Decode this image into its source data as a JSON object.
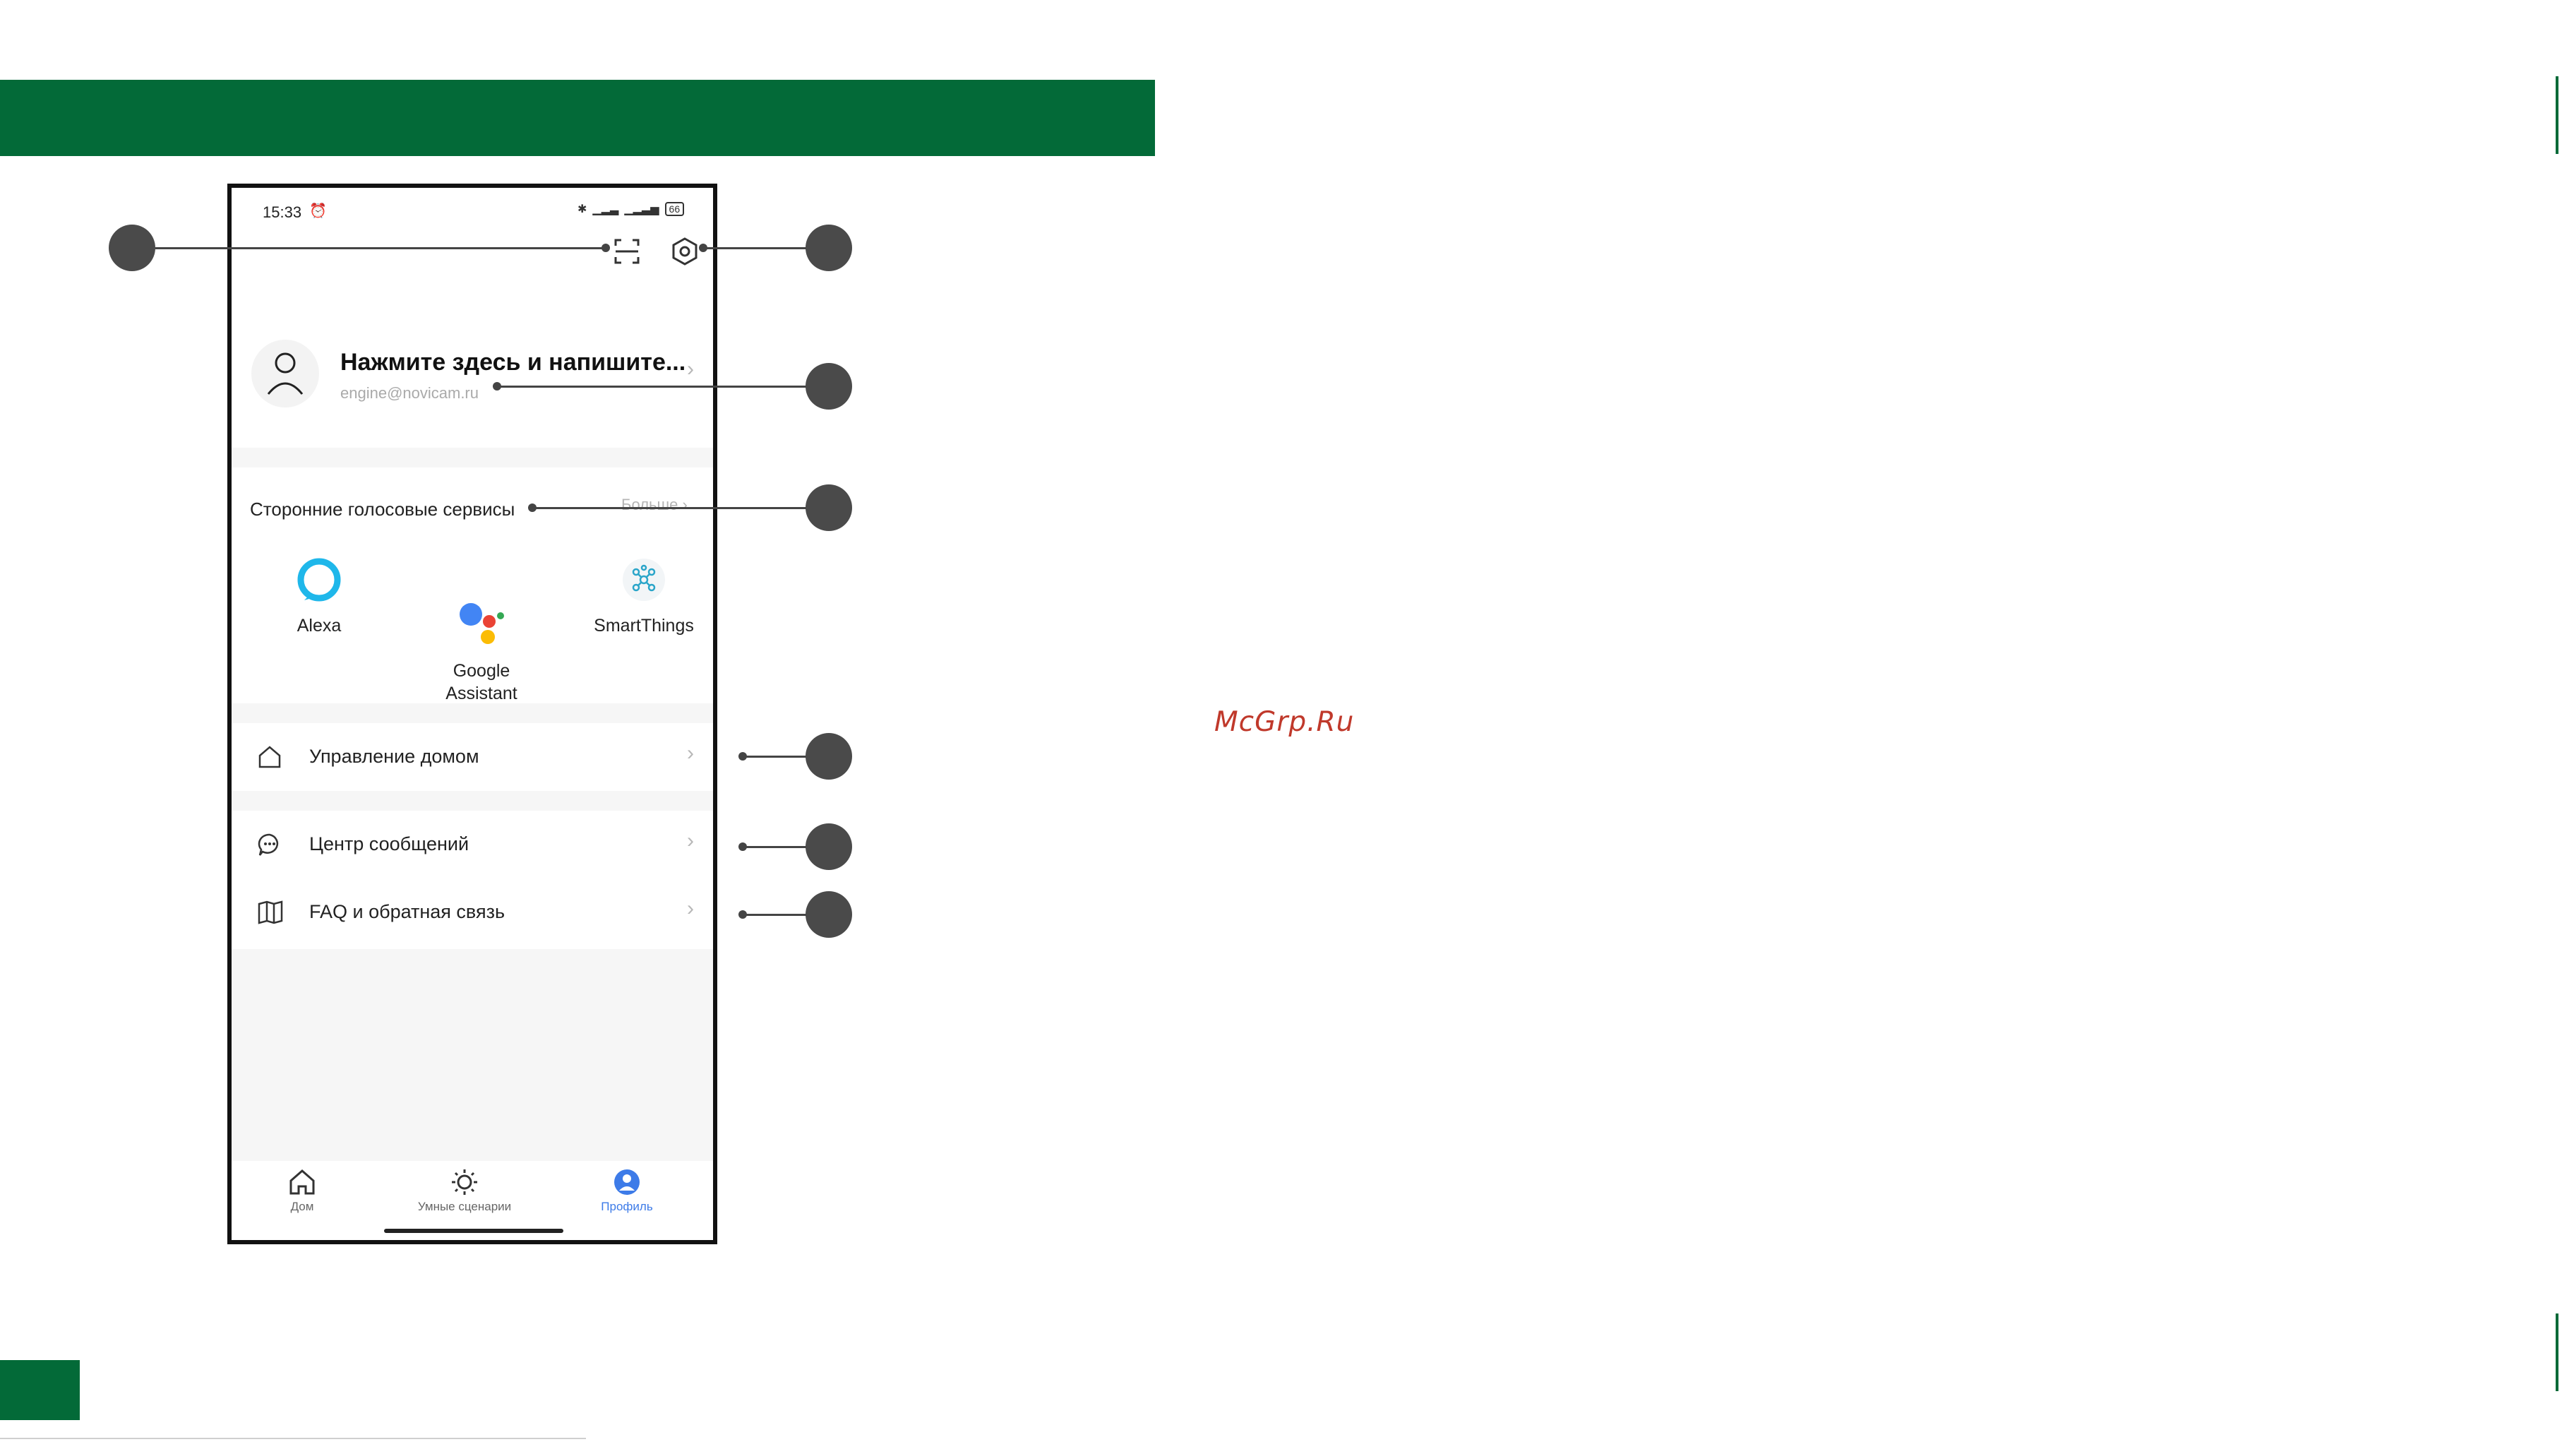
{
  "watermark": "McGrp.Ru",
  "colors": {
    "brand_green": "#036A38",
    "accent_blue": "#3d7be8"
  },
  "status_bar": {
    "time": "15:33",
    "battery": "66",
    "icons": [
      "alarm-icon",
      "bluetooth-icon",
      "signal-4g-icon",
      "signal-icon",
      "battery-icon"
    ]
  },
  "toolbar": {
    "icons": [
      "scan-icon",
      "settings-icon"
    ]
  },
  "profile": {
    "title": "Нажмите здесь и напишите...",
    "email": "engine@novicam.ru"
  },
  "voice_services": {
    "title": "Сторонние голосовые сервисы",
    "more": "Больше",
    "items": [
      {
        "label": "Alexa"
      },
      {
        "label": "Google\nAssistant"
      },
      {
        "label": "SmartThings"
      }
    ]
  },
  "menu": {
    "home_management": "Управление домом",
    "message_center": "Центр сообщений",
    "faq": "FAQ и обратная связь"
  },
  "bottom_nav": [
    {
      "label": "Дом",
      "active": false
    },
    {
      "label": "Умные сценарии",
      "active": false
    },
    {
      "label": "Профиль",
      "active": true
    }
  ]
}
